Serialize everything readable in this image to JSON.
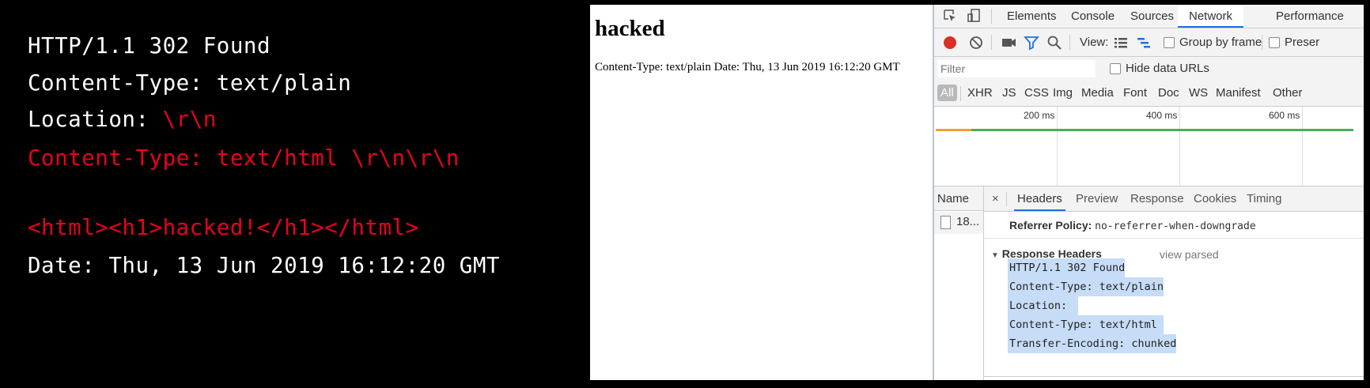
{
  "code": {
    "lines": [
      {
        "text": "HTTP/1.1 302 Found",
        "color": "#ffffff"
      },
      {
        "text": "Content-Type: text/plain",
        "color": "#ffffff"
      },
      {
        "prefix": "Location: ",
        "suffix": "\\r\\n",
        "prefix_color": "#ffffff",
        "suffix_color": "#e8001e"
      },
      {
        "text": "Content-Type: text/html \\r\\n\\r\\n",
        "color": "#e8001e"
      },
      {
        "text": "<html><h1>hacked!</h1></html>",
        "color": "#e8001e"
      },
      {
        "text": "Date: Thu, 13 Jun 2019 16:12:20 GMT",
        "color": "#ffffff"
      }
    ]
  },
  "page": {
    "heading": "hacked",
    "body": "Content-Type: text/plain Date: Thu, 13 Jun 2019 16:12:20 GMT"
  },
  "devtools": {
    "tabs": [
      "Elements",
      "Console",
      "Sources",
      "Network",
      "Performance"
    ],
    "active_tab": "Network",
    "toolbar": {
      "view_label": "View:",
      "group_by_frame": "Group by frame",
      "preserve": "Preser"
    },
    "filter": {
      "placeholder": "Filter",
      "hide_data_urls": "Hide data URLs"
    },
    "types": [
      "All",
      "XHR",
      "JS",
      "CSS",
      "Img",
      "Media",
      "Font",
      "Doc",
      "WS",
      "Manifest",
      "Other"
    ],
    "timeline": {
      "ticks": [
        "200 ms",
        "400 ms",
        "600 ms"
      ]
    },
    "name_header": "Name",
    "request_name": "18...",
    "detail_tabs": [
      "Headers",
      "Preview",
      "Response",
      "Cookies",
      "Timing"
    ],
    "close_glyph": "×",
    "referrer_label": "Referrer Policy:",
    "referrer_value": "no-referrer-when-downgrade",
    "response_headers_title": "Response Headers",
    "view_parsed": "view parsed",
    "response_headers": [
      "HTTP/1.1 302 Found",
      "Content-Type: text/plain",
      "Location:",
      "Content-Type: text/html",
      "Transfer-Encoding: chunked"
    ]
  },
  "colors": {
    "accent": "#1a73e8",
    "record_red": "#d93025",
    "selection": "#c6dcf7",
    "code_red": "#e8001e"
  }
}
